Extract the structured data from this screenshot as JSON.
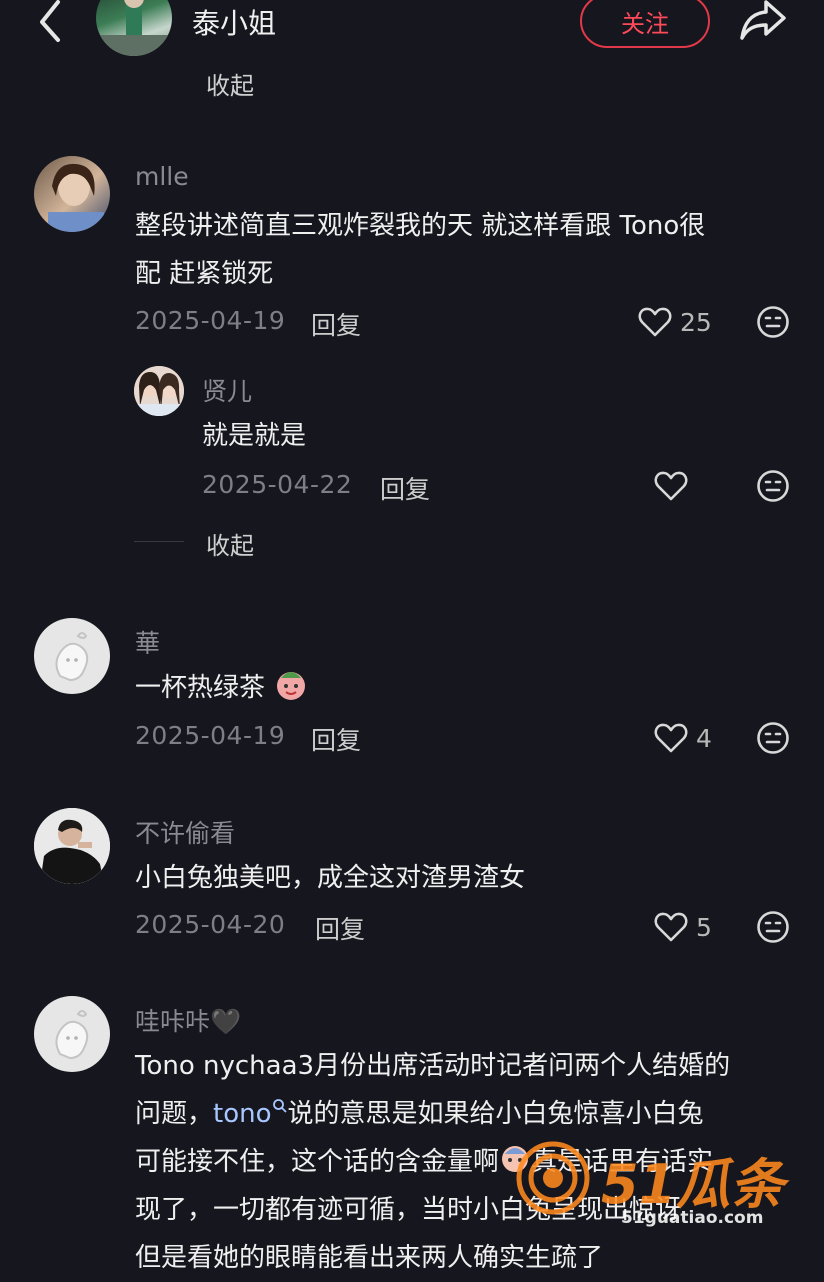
{
  "header": {
    "title": "泰小姐",
    "follow_label": "关注"
  },
  "collapse_top": "收起",
  "comments": [
    {
      "username": "mlle",
      "content_line1": "整段讲述简直三观炸裂我的天 就这样看跟 Tono很",
      "content_line2": "配 赶紧锁死",
      "date": "2025-04-19",
      "reply_label": "回复",
      "likes": "25",
      "replies": [
        {
          "username": "贤儿",
          "content": "就是就是",
          "date": "2025-04-22",
          "reply_label": "回复"
        }
      ],
      "collapse_label": "收起"
    },
    {
      "username": "華",
      "content": "一杯热绿茶",
      "emoji": "tea-face-sticker",
      "date": "2025-04-19",
      "reply_label": "回复",
      "likes": "4"
    },
    {
      "username": "不许偷看",
      "content": "小白兔独美吧，成全这对渣男渣女",
      "date": "2025-04-20",
      "reply_label": "回复",
      "likes": "5"
    },
    {
      "username": "哇咔咔",
      "username_emoji": "🖤",
      "line1": "Tono nychaa3月份出席活动时记者问两个人结婚的",
      "line2_a": "问题，",
      "line2_mention": "tono",
      "line2_b": "说的意思是如果给小白兔惊喜小白兔",
      "line3": "可能接不住，这个话的含金量啊",
      "line3_b": "真是话里有话实",
      "line4": "现了，一切都有迹可循，当时",
      "line4_b": "小白兔呈现出惊讶",
      "line5": "但是看她的眼睛能看出来两人确实生疏了"
    }
  ],
  "watermark": {
    "brand": "51瓜条",
    "url": "51guatiao.com"
  },
  "colors": {
    "background": "#16161e",
    "follow_red": "#e03a4a",
    "mention_blue": "#a9c7ff",
    "watermark_orange": "#ff8a1e"
  }
}
